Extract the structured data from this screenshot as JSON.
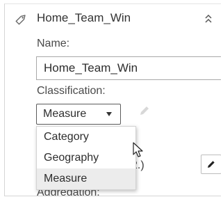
{
  "header": {
    "title": "Home_Team_Win",
    "icon": "tag-icon",
    "collapse_icon": "chevron-up-icon"
  },
  "form": {
    "name_label": "Name:",
    "name_value": "Home_Team_Win",
    "classification_label": "Classification:",
    "classification_value": "Measure",
    "classification_options": [
      "Category",
      "Geography",
      "Measure"
    ],
    "obscured_text_fragment": "2.)",
    "aggregation_label": "Aggregation:"
  },
  "colors": {
    "border": "#a8a8a8",
    "selected_option_bg": "#ececec",
    "text": "#2d2d2d"
  }
}
